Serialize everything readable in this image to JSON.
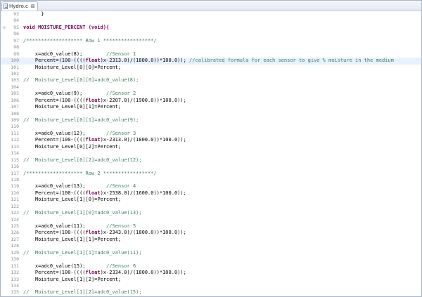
{
  "editor": {
    "tab": {
      "title": "Hydro.c",
      "close": "⊠"
    },
    "lines": [
      {
        "n": "93",
        "fold": "",
        "segs": [
          {
            "t": "      }",
            "c": ""
          }
        ]
      },
      {
        "n": "94",
        "fold": "",
        "segs": [
          {
            "t": "",
            "c": ""
          }
        ]
      },
      {
        "n": "95",
        "fold": "⊖",
        "segs": [
          {
            "t": "void MOISTURE_PERCENT (void){",
            "c": "kw"
          }
        ]
      },
      {
        "n": "96",
        "fold": "",
        "segs": [
          {
            "t": "",
            "c": ""
          }
        ]
      },
      {
        "n": "97",
        "fold": "",
        "segs": [
          {
            "t": "/******************* Row 1 *****************/",
            "c": "cm"
          }
        ]
      },
      {
        "n": "98",
        "fold": "",
        "segs": [
          {
            "t": "",
            "c": ""
          }
        ]
      },
      {
        "n": "99",
        "fold": "",
        "segs": [
          {
            "t": "    x=adc0_value(8);        ",
            "c": ""
          },
          {
            "t": "//Sensor 1",
            "c": "cm"
          }
        ]
      },
      {
        "n": "100",
        "fold": "",
        "cur": true,
        "segs": [
          {
            "t": "    Percent=(100-((((",
            "c": ""
          },
          {
            "t": "float",
            "c": "kw"
          },
          {
            "t": ")x-2313.0)/(1800.0))*100.0)); ",
            "c": ""
          },
          {
            "t": "//calibrated formula for each sensor to give % moisture in the medium",
            "c": "cm"
          }
        ]
      },
      {
        "n": "101",
        "fold": "",
        "segs": [
          {
            "t": "    Moisture_Level[0][0]=Percent;",
            "c": ""
          }
        ]
      },
      {
        "n": "102",
        "fold": "",
        "segs": [
          {
            "t": "",
            "c": ""
          }
        ]
      },
      {
        "n": "103",
        "fold": "",
        "segs": [
          {
            "t": "//  Moisture_Level[0][0]=adc0_value(8);",
            "c": "cm"
          }
        ]
      },
      {
        "n": "104",
        "fold": "",
        "segs": [
          {
            "t": "",
            "c": ""
          }
        ]
      },
      {
        "n": "105",
        "fold": "",
        "segs": [
          {
            "t": "    x=adc0_value(9);        ",
            "c": ""
          },
          {
            "t": "//Sensor 2",
            "c": "cm"
          }
        ]
      },
      {
        "n": "106",
        "fold": "",
        "segs": [
          {
            "t": "    Percent=(100-((((",
            "c": ""
          },
          {
            "t": "float",
            "c": "kw"
          },
          {
            "t": ")x-2207.0)/(1900.0))*100.0));",
            "c": ""
          }
        ]
      },
      {
        "n": "107",
        "fold": "",
        "segs": [
          {
            "t": "    Moisture_Level[0][1]=Percent;",
            "c": ""
          }
        ]
      },
      {
        "n": "108",
        "fold": "",
        "segs": [
          {
            "t": "",
            "c": ""
          }
        ]
      },
      {
        "n": "109",
        "fold": "",
        "segs": [
          {
            "t": "//  Moisture_Level[0][1]=adc0_value(9);",
            "c": "cm"
          }
        ]
      },
      {
        "n": "110",
        "fold": "",
        "segs": [
          {
            "t": "",
            "c": ""
          }
        ]
      },
      {
        "n": "111",
        "fold": "",
        "segs": [
          {
            "t": "    x=adc0_value(12);       ",
            "c": ""
          },
          {
            "t": "//Sensor 3",
            "c": "cm"
          }
        ]
      },
      {
        "n": "112",
        "fold": "",
        "segs": [
          {
            "t": "    Percent=(100-((((",
            "c": ""
          },
          {
            "t": "float",
            "c": "kw"
          },
          {
            "t": ")x-2313.0)/(1800.0))*100.0));",
            "c": ""
          }
        ]
      },
      {
        "n": "113",
        "fold": "",
        "segs": [
          {
            "t": "    Moisture_Level[0][2]=Percent;",
            "c": ""
          }
        ]
      },
      {
        "n": "114",
        "fold": "",
        "segs": [
          {
            "t": "",
            "c": ""
          }
        ]
      },
      {
        "n": "115",
        "fold": "",
        "segs": [
          {
            "t": "//  Moisture_Level[0][2]=adc0_value(12);",
            "c": "cm"
          }
        ]
      },
      {
        "n": "116",
        "fold": "",
        "segs": [
          {
            "t": "",
            "c": ""
          }
        ]
      },
      {
        "n": "117",
        "fold": "",
        "segs": [
          {
            "t": "/******************* Row 2 *****************/",
            "c": "cm"
          }
        ]
      },
      {
        "n": "118",
        "fold": "",
        "segs": [
          {
            "t": "",
            "c": ""
          }
        ]
      },
      {
        "n": "119",
        "fold": "",
        "segs": [
          {
            "t": "    x=adc0_value(13);       ",
            "c": ""
          },
          {
            "t": "//Sensor 4",
            "c": "cm"
          }
        ]
      },
      {
        "n": "120",
        "fold": "",
        "segs": [
          {
            "t": "    Percent=(100-((((",
            "c": ""
          },
          {
            "t": "float",
            "c": "kw"
          },
          {
            "t": ")x-2538.0)/(1600.0))*100.0));",
            "c": ""
          }
        ]
      },
      {
        "n": "121",
        "fold": "",
        "segs": [
          {
            "t": "    Moisture_Level[1][0]=Percent;",
            "c": ""
          }
        ]
      },
      {
        "n": "122",
        "fold": "",
        "segs": [
          {
            "t": "",
            "c": ""
          }
        ]
      },
      {
        "n": "123",
        "fold": "",
        "segs": [
          {
            "t": "//  Moisture_Level[1][0]=adc0_value(13);",
            "c": "cm"
          }
        ]
      },
      {
        "n": "124",
        "fold": "",
        "segs": [
          {
            "t": "",
            "c": ""
          }
        ]
      },
      {
        "n": "125",
        "fold": "",
        "segs": [
          {
            "t": "    x=adc0_value(11);       ",
            "c": ""
          },
          {
            "t": "//Sensor 5",
            "c": "cm"
          }
        ]
      },
      {
        "n": "126",
        "fold": "",
        "segs": [
          {
            "t": "    Percent=(100-((((",
            "c": ""
          },
          {
            "t": "float",
            "c": "kw"
          },
          {
            "t": ")x-2343.0)/(1800.0))*100.0));",
            "c": ""
          }
        ]
      },
      {
        "n": "127",
        "fold": "",
        "segs": [
          {
            "t": "    Moisture_Level[1][1]=Percent;",
            "c": ""
          }
        ]
      },
      {
        "n": "128",
        "fold": "",
        "segs": [
          {
            "t": "",
            "c": ""
          }
        ]
      },
      {
        "n": "129",
        "fold": "",
        "segs": [
          {
            "t": "//  Moisture_Level[1][1]=adc0_value(11);",
            "c": "cm"
          }
        ]
      },
      {
        "n": "130",
        "fold": "",
        "segs": [
          {
            "t": "",
            "c": ""
          }
        ]
      },
      {
        "n": "131",
        "fold": "",
        "segs": [
          {
            "t": "    x=adc0_value(15);       ",
            "c": ""
          },
          {
            "t": "//Sensor 6",
            "c": "cm"
          }
        ]
      },
      {
        "n": "132",
        "fold": "",
        "segs": [
          {
            "t": "    Percent=(100-((((",
            "c": ""
          },
          {
            "t": "float",
            "c": "kw"
          },
          {
            "t": ")x-2334.0)/(1800.0))*100.0));",
            "c": ""
          }
        ]
      },
      {
        "n": "133",
        "fold": "",
        "segs": [
          {
            "t": "    Moisture_Level[1][2]=Percent;",
            "c": ""
          }
        ]
      },
      {
        "n": "134",
        "fold": "",
        "segs": [
          {
            "t": "",
            "c": ""
          }
        ]
      },
      {
        "n": "135",
        "fold": "",
        "segs": [
          {
            "t": "//  Moisture_Level[1][2]=adc0_value(15);",
            "c": "cm"
          }
        ]
      }
    ]
  },
  "colors": {
    "keyword": "#7f0055",
    "comment": "#3f7f5f",
    "current_line": "#e8f2fe"
  },
  "icons": {
    "tab_file": "c-file-icon",
    "tab_close": "close-icon",
    "fold": "collapse-icon"
  }
}
